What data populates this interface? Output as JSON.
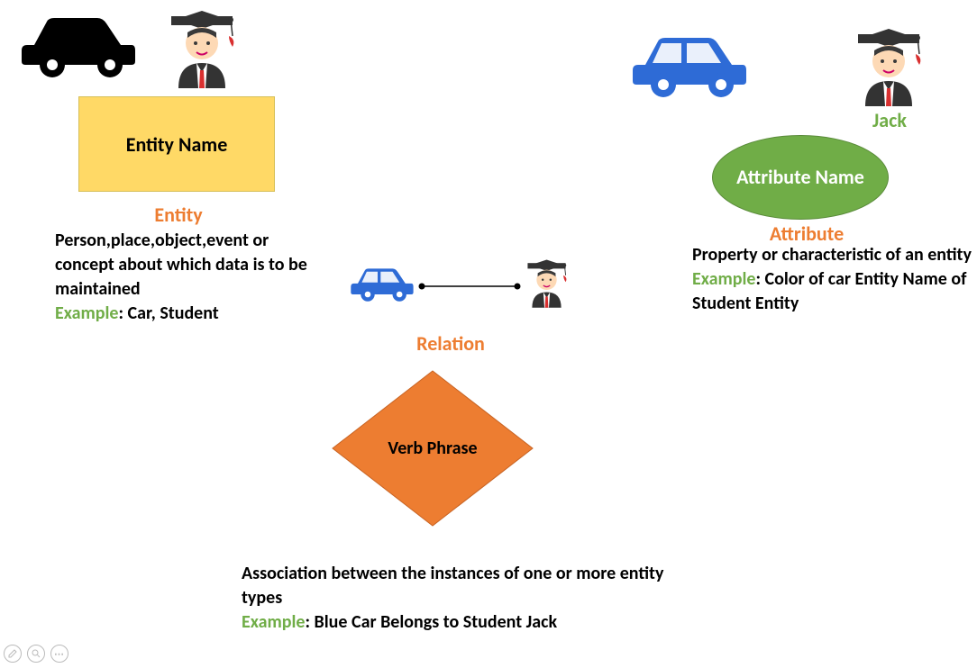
{
  "entity": {
    "box_label": "Entity Name",
    "title": "Entity",
    "desc": "Person,place,object,event or concept about which data is to be maintained",
    "example_label": "Example",
    "example_text": ": Car, Student"
  },
  "attribute": {
    "jack_label": "Jack",
    "ellipse_label": "Attribute Name",
    "title": "Attribute",
    "desc": "Property or characteristic of an entity",
    "example_label": "Example",
    "example_text": ": Color of car Entity Name of Student Entity"
  },
  "relation": {
    "title": "Relation",
    "diamond_label": "Verb Phrase",
    "desc": "Association between the instances of one or more entity types",
    "example_label": "Example",
    "example_text": ": Blue Car Belongs to Student Jack"
  }
}
